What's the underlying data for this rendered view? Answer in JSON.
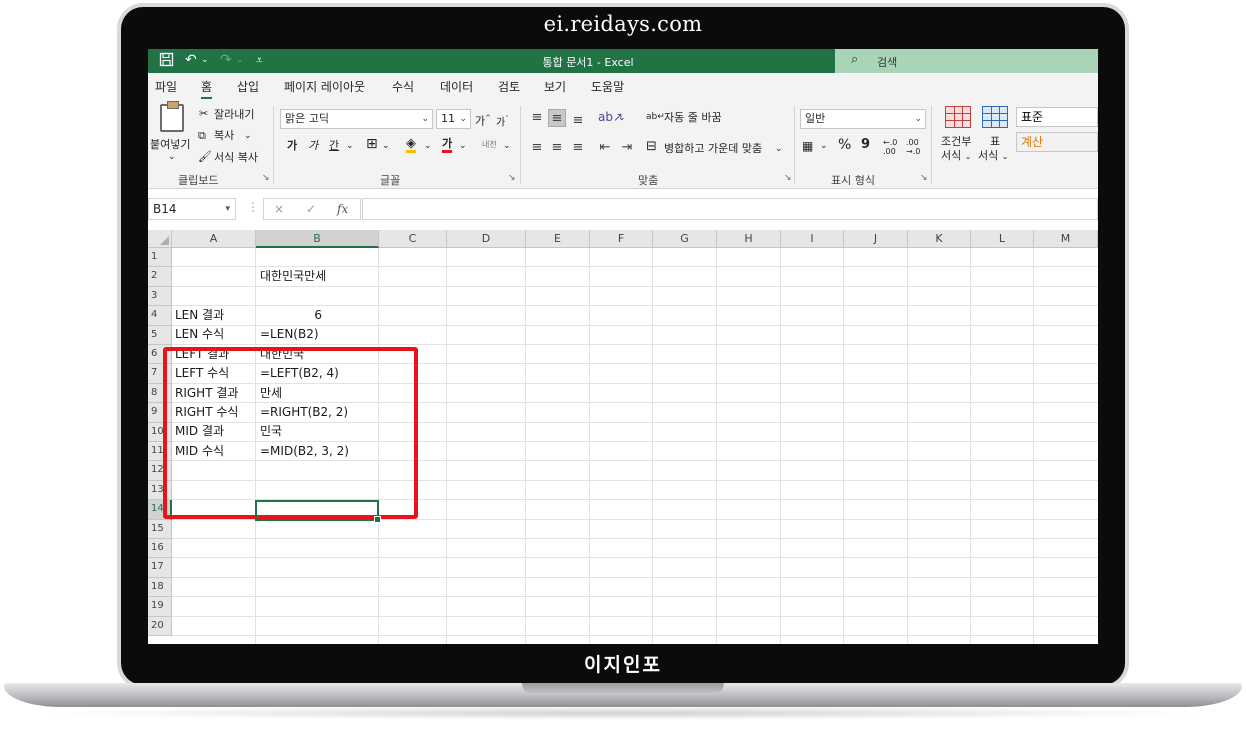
{
  "overlay": {
    "site_title": "ei.reidays.com",
    "brand": "이지인포"
  },
  "titlebar": {
    "title": "통합 문서1  -  Excel",
    "search_label": "검색",
    "save_icon": "save-icon",
    "undo_icon": "undo-icon",
    "redo_icon": "redo-icon",
    "qat_icon": "customize-qat-icon"
  },
  "menu": {
    "tabs": [
      "파일",
      "홈",
      "삽입",
      "페이지 레이아웃",
      "수식",
      "데이터",
      "검토",
      "보기",
      "도움말"
    ],
    "active": "홈"
  },
  "ribbon": {
    "clipboard": {
      "paste": "붙여넣기",
      "cut": "잘라내기",
      "copy": "복사",
      "format_painter": "서식 복사",
      "label": "클립보드"
    },
    "font": {
      "font_name": "맑은 고딕",
      "font_size": "11",
      "grow": "가",
      "shrink": "가",
      "bold": "가",
      "italic": "가",
      "underline": "간",
      "font_color_glyph": "가",
      "phonetic": "내천",
      "label": "글꼴"
    },
    "alignment": {
      "wrap_text": "자동 줄 바꿈",
      "merge_center": "병합하고 가운데 맞춤",
      "label": "맞춤"
    },
    "number": {
      "format": "일반",
      "percent": "%",
      "comma": "9",
      "increase_decimal": "←.0 .00",
      "decrease_decimal": ".00 →.0",
      "label": "표시 형식"
    },
    "styles": {
      "conditional_line1": "조건부",
      "conditional_line2": "서식",
      "table_line1": "표",
      "table_line2": "서식",
      "style_normal": "표준",
      "style_calc": "계산"
    }
  },
  "formula_bar": {
    "name_box": "B14",
    "fx": "fx",
    "cancel": "×",
    "enter": "✓",
    "content": ""
  },
  "sheet": {
    "columns": [
      "A",
      "B",
      "C",
      "D",
      "E",
      "F",
      "G",
      "H",
      "I",
      "J",
      "K",
      "L",
      "M"
    ],
    "rows": [
      "1",
      "2",
      "3",
      "4",
      "5",
      "6",
      "7",
      "8",
      "9",
      "10",
      "11",
      "12",
      "13",
      "14",
      "15",
      "16",
      "17",
      "18",
      "19",
      "20"
    ],
    "cells": {
      "B2": "대한민국만세",
      "A4": "LEN 결과",
      "B4": "6",
      "A5": "LEN 수식",
      "B5": "=LEN(B2)",
      "A6": "LEFT 결과",
      "B6": "대한민국",
      "A7": "LEFT 수식",
      "B7": "=LEFT(B2, 4)",
      "A8": "RIGHT 결과",
      "B8": "만세",
      "A9": "RIGHT 수식",
      "B9": "=RIGHT(B2, 2)",
      "A10": "MID 결과",
      "B10": "민국",
      "A11": "MID 수식",
      "B11": "=MID(B2, 3, 2)"
    },
    "active_cell": "B14",
    "highlight_color": "#e5141a",
    "accent_color": "#217346"
  }
}
